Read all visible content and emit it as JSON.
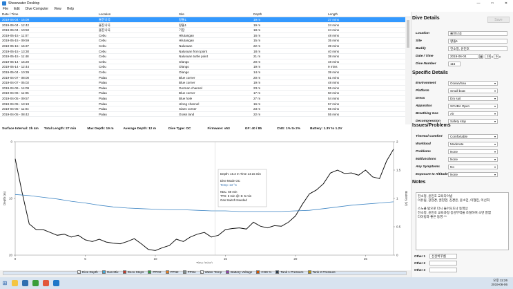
{
  "window": {
    "title": "Shearwater Desktop",
    "min_icon": "minimize-icon",
    "max_icon": "maximize-icon",
    "close_icon": "close-icon"
  },
  "menu": [
    "File",
    "Edit",
    "Dive Computer",
    "View",
    "Help"
  ],
  "table": {
    "columns": [
      "Date / Time",
      "Location",
      "Site",
      "Depth",
      "Length"
    ],
    "rows": [
      [
        "2019-06-04 - 15:09",
        "울진나곡",
        "왕돌1",
        "19 m",
        "27 mins"
      ],
      [
        "2019-06-04 - 12:42",
        "울진나곡",
        "왕돌1",
        "19 m",
        "24 mins"
      ],
      [
        "2019-06-04 - 10:50",
        "울진나곡",
        "기장",
        "18 m",
        "24 mins"
      ],
      [
        "2019-05-15 - 11:07",
        "Cebu",
        "Hilutangan",
        "16 m",
        "48 mins"
      ],
      [
        "2019-05-15 - 09:59",
        "Cebu",
        "Hilutangan",
        "15 m",
        "35 mins"
      ],
      [
        "2019-05-15 - 15:37",
        "Cebu",
        "Nalusuan",
        "22 m",
        "39 mins"
      ],
      [
        "2019-05-15 - 13:30",
        "Cebu",
        "Nalusuan front point",
        "18 m",
        "40 mins"
      ],
      [
        "2019-05-15 - 11:48",
        "Cebu",
        "Nalusuan turtle point",
        "21 m",
        "38 mins"
      ],
      [
        "2019-05-14 - 15:20",
        "Cebu",
        "Olango",
        "20 m",
        "48 mins"
      ],
      [
        "2019-05-14 - 12:44",
        "Cebu",
        "Olango",
        "19 m",
        "9 mins"
      ],
      [
        "2019-05-04 - 10:39",
        "Cebu",
        "Olango",
        "14 m",
        "39 mins"
      ],
      [
        "2019-04-07 - 08:00",
        "Palau",
        "Blue corner",
        "20 m",
        "51 mins"
      ],
      [
        "2019-04-07 - 05:02",
        "Palau",
        "Blue corner",
        "19 m",
        "48 mins"
      ],
      [
        "2019-04-06 - 14:09",
        "Palau",
        "German channel",
        "23 m",
        "55 mins"
      ],
      [
        "2019-04-06 - 11:05",
        "Palau",
        "Blue corner",
        "17 m",
        "50 mins"
      ],
      [
        "2019-04-05 - 09:57",
        "Palau",
        "Blue hole",
        "27 m",
        "54 mins"
      ],
      [
        "2019-04-05 - 13:19",
        "Palau",
        "Ulong channel",
        "16 m",
        "57 mins"
      ],
      [
        "2019-04-05 - 11:04",
        "Palau",
        "Siaes corner",
        "23 m",
        "55 mins"
      ],
      [
        "2019-04-05 - 08:42",
        "Palau",
        "Grass land",
        "22 m",
        "55 mins"
      ]
    ]
  },
  "stats": {
    "surface_interval": "Surface Interval: 2h 4m",
    "total_length": "Total Length: 27 min",
    "max_depth": "Max Depth: 19 m",
    "avg_depth": "Average Depth: 12 m",
    "dive_type": "Dive Type: OC",
    "firmware": "Firmware: v53",
    "gf": "GF: 40 / 85",
    "cns": "CNS: 1% to 2%",
    "battery": "Battery: 1.3V to 1.2V"
  },
  "chart_data": {
    "type": "line",
    "xlabel": "Time (mins)",
    "ylabel": "Depth (m)",
    "y2label": "Battery (V)",
    "xlim": [
      0,
      27
    ],
    "xticks": [
      0,
      5,
      10,
      15,
      20,
      25
    ],
    "ylim": [
      20,
      0
    ],
    "yticks": [
      0,
      10,
      20
    ],
    "y2lim": [
      0,
      2
    ],
    "y2ticks": [
      0,
      0.5,
      1,
      1.5,
      2
    ],
    "grid": false,
    "series": [
      {
        "name": "Dive Depth",
        "color": "#111111",
        "x": [
          0,
          0.5,
          1,
          1.5,
          2,
          2.5,
          3,
          3.5,
          4,
          4.5,
          5,
          5.5,
          6,
          6.5,
          7,
          7.5,
          8,
          8.5,
          9,
          9.5,
          10,
          10.5,
          11,
          11.5,
          12,
          12.5,
          13,
          13.5,
          14,
          14.5,
          15,
          15.5,
          16,
          16.5,
          17,
          17.5,
          18,
          18.5,
          19,
          19.5,
          20,
          20.5,
          21,
          21.5,
          22,
          22.5,
          23,
          23.5,
          24,
          24.5,
          25,
          25.5,
          26,
          26.5,
          27
        ],
        "y": [
          3,
          9,
          14.5,
          15.5,
          15.5,
          16,
          16.5,
          16.3,
          16.8,
          16.5,
          17.3,
          17.6,
          17.2,
          17.7,
          17.9,
          18,
          17.6,
          17.1,
          18,
          19,
          19.2,
          18.7,
          18.3,
          17.2,
          17.6,
          16.8,
          16.3,
          16,
          16.8,
          16.5,
          15.5,
          15.3,
          15.2,
          15.4,
          14.2,
          14.9,
          15.2,
          14.8,
          14.9,
          14.2,
          13.1,
          11,
          9.2,
          8.5,
          7.4,
          5.5,
          5,
          5.6,
          5.5,
          5.9,
          5,
          6.2,
          6.5,
          3.4,
          1.3
        ]
      },
      {
        "name": "Water Temp",
        "color": "#3f86c4",
        "x": [
          0,
          1,
          2,
          3,
          4,
          5,
          6,
          7,
          8,
          9,
          10,
          11,
          12,
          13,
          14,
          15,
          16,
          17,
          18,
          19,
          20,
          21,
          22,
          23,
          24,
          25,
          26,
          27
        ],
        "y": [
          9.3,
          9.5,
          9.8,
          10.1,
          10.5,
          10.8,
          11.2,
          11.5,
          11.7,
          11.8,
          11.9,
          12,
          12,
          12.1,
          12.2,
          12.2,
          12.3,
          12.3,
          12.3,
          12.3,
          12.2,
          12.1,
          11.8,
          11.5,
          11.2,
          11,
          10.8,
          10.6
        ]
      }
    ],
    "tooltip": {
      "header": "Depth: 16.3 m Time 14:15 min",
      "dive_mode": "Dive Mode OC",
      "temp": "Temp: 13 °C",
      "ndl": "NDL: 59 min",
      "tts": "TTS: 5 min  @+5: 5 min",
      "gas": "Gas Switch Needed"
    }
  },
  "legend": [
    {
      "label": "Dive Depth",
      "checked": true,
      "color": "#222222"
    },
    {
      "label": "Gas Mix",
      "checked": false,
      "color": "#3fa7d6"
    },
    {
      "label": "Deco Stops",
      "checked": false,
      "color": "#c0392b"
    },
    {
      "label": "PPO2",
      "checked": false,
      "color": "#2e9e44"
    },
    {
      "label": "PPN2",
      "checked": false,
      "color": "#e67e22"
    },
    {
      "label": "PPHe",
      "checked": false,
      "color": "#7f8c8d"
    },
    {
      "label": "Water Temp",
      "checked": true,
      "color": "#2f6fb0"
    },
    {
      "label": "Battery Voltage",
      "checked": false,
      "color": "#8e44ad"
    },
    {
      "label": "CNS %",
      "checked": false,
      "color": "#d35400"
    },
    {
      "label": "Tank 1 Pressure",
      "checked": false,
      "color": "#2c3e50"
    },
    {
      "label": "Tank 2 Pressure",
      "checked": false,
      "color": "#b7950b"
    }
  ],
  "dive_details": {
    "heading": "Dive Details",
    "save": "Save",
    "fields": [
      {
        "label": "Location",
        "value": "울진나곡"
      },
      {
        "label": "Site",
        "value": "왕돌1"
      },
      {
        "label": "Buddy",
        "value": "전소정, 윤민호"
      },
      {
        "label": "Date / Time",
        "value": "2019-06-04",
        "hour": "15",
        "minute": "9"
      },
      {
        "label": "Dive Number",
        "value": "115"
      }
    ]
  },
  "specific_details": {
    "heading": "Specific Details",
    "fields": [
      {
        "label": "Environment",
        "value": "Ocean/Sea"
      },
      {
        "label": "Platform",
        "value": "Small boat"
      },
      {
        "label": "Dress",
        "value": "Dry suit"
      },
      {
        "label": "Apparatus",
        "value": "SCUBA Open"
      },
      {
        "label": "Breathing Gas",
        "value": "Air"
      },
      {
        "label": "Decompression",
        "value": "Safety stop"
      }
    ]
  },
  "issues": {
    "heading": "Issues/Problems",
    "fields": [
      {
        "label": "Thermal Comfort",
        "value": "Comfortable"
      },
      {
        "label": "Workload",
        "value": "Moderate"
      },
      {
        "label": "Problems",
        "value": "None"
      },
      {
        "label": "Malfunctions",
        "value": "None"
      },
      {
        "label": "Any Symptoms",
        "value": "No"
      },
      {
        "label": "Exposure to Altitude",
        "value": "None"
      }
    ]
  },
  "notes": {
    "heading": "Notes",
    "text": "전소정, 윤민호 교육다이빙\n이유림, 장현경, 권현영, 김경은, 윤소민, 이형민, 이선희\n\n스노클 탑으로 다시 들어오도나 동영상\n전소정, 윤민호 교육과정 증성부력을 조절하며 소변 잘함\n다이빙과 좋은 동영 ^^"
  },
  "others": [
    {
      "label": "Other 1",
      "value": "선상바꾸름"
    },
    {
      "label": "Other 2",
      "value": ""
    },
    {
      "label": "Other 3",
      "value": ""
    }
  ],
  "taskbar": {
    "time": "오후 11:26",
    "date": "2019-06-06"
  }
}
